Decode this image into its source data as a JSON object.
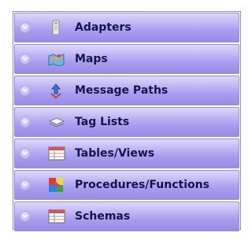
{
  "nav": {
    "items": [
      {
        "label": "Adapters",
        "icon": "adapter-icon"
      },
      {
        "label": "Maps",
        "icon": "maps-icon"
      },
      {
        "label": "Message Paths",
        "icon": "message-paths-icon"
      },
      {
        "label": "Tag Lists",
        "icon": "tag-lists-icon"
      },
      {
        "label": "Tables/Views",
        "icon": "table-icon"
      },
      {
        "label": "Procedures/Functions",
        "icon": "procedures-icon"
      },
      {
        "label": "Schemas",
        "icon": "schema-icon"
      }
    ]
  },
  "colors": {
    "bar_top": "#ded7fb",
    "bar_bottom": "#978be6",
    "label_text": "#15154a"
  }
}
